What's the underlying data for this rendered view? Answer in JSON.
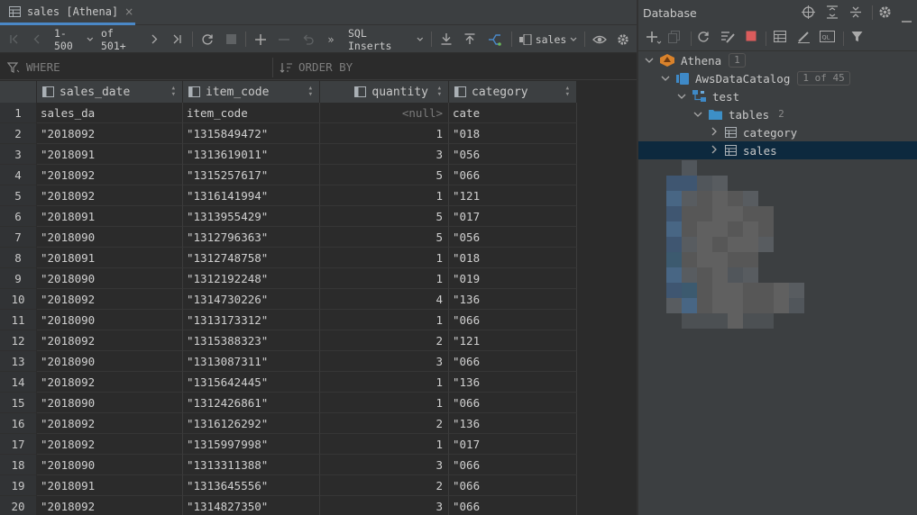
{
  "editor_tab": {
    "label": "sales [Athena]",
    "close": "×"
  },
  "toolbar": {
    "page_range": "1-500",
    "page_total": "of 501+",
    "export_format": "SQL Inserts",
    "schema": "sales"
  },
  "filter": {
    "where_label": "WHERE",
    "order_by_label": "ORDER BY"
  },
  "grid": {
    "columns": [
      "sales_date",
      "item_code",
      "quantity",
      "category"
    ],
    "rows": [
      {
        "n": "1",
        "sales_date": "sales_da",
        "item_code": "item_code",
        "quantity": "<null>",
        "category": "cate"
      },
      {
        "n": "2",
        "sales_date": "\"2018092",
        "item_code": "\"1315849472\"",
        "quantity": "1",
        "category": "\"018"
      },
      {
        "n": "3",
        "sales_date": "\"2018091",
        "item_code": "\"1313619011\"",
        "quantity": "3",
        "category": "\"056"
      },
      {
        "n": "4",
        "sales_date": "\"2018092",
        "item_code": "\"1315257617\"",
        "quantity": "5",
        "category": "\"066"
      },
      {
        "n": "5",
        "sales_date": "\"2018092",
        "item_code": "\"1316141994\"",
        "quantity": "1",
        "category": "\"121"
      },
      {
        "n": "6",
        "sales_date": "\"2018091",
        "item_code": "\"1313955429\"",
        "quantity": "5",
        "category": "\"017"
      },
      {
        "n": "7",
        "sales_date": "\"2018090",
        "item_code": "\"1312796363\"",
        "quantity": "5",
        "category": "\"056"
      },
      {
        "n": "8",
        "sales_date": "\"2018091",
        "item_code": "\"1312748758\"",
        "quantity": "1",
        "category": "\"018"
      },
      {
        "n": "9",
        "sales_date": "\"2018090",
        "item_code": "\"1312192248\"",
        "quantity": "1",
        "category": "\"019"
      },
      {
        "n": "10",
        "sales_date": "\"2018092",
        "item_code": "\"1314730226\"",
        "quantity": "4",
        "category": "\"136"
      },
      {
        "n": "11",
        "sales_date": "\"2018090",
        "item_code": "\"1313173312\"",
        "quantity": "1",
        "category": "\"066"
      },
      {
        "n": "12",
        "sales_date": "\"2018092",
        "item_code": "\"1315388323\"",
        "quantity": "2",
        "category": "\"121"
      },
      {
        "n": "13",
        "sales_date": "\"2018090",
        "item_code": "\"1313087311\"",
        "quantity": "3",
        "category": "\"066"
      },
      {
        "n": "14",
        "sales_date": "\"2018092",
        "item_code": "\"1315642445\"",
        "quantity": "1",
        "category": "\"136"
      },
      {
        "n": "15",
        "sales_date": "\"2018090",
        "item_code": "\"1312426861\"",
        "quantity": "1",
        "category": "\"066"
      },
      {
        "n": "16",
        "sales_date": "\"2018092",
        "item_code": "\"1316126292\"",
        "quantity": "2",
        "category": "\"136"
      },
      {
        "n": "17",
        "sales_date": "\"2018092",
        "item_code": "\"1315997998\"",
        "quantity": "1",
        "category": "\"017"
      },
      {
        "n": "18",
        "sales_date": "\"2018090",
        "item_code": "\"1313311388\"",
        "quantity": "3",
        "category": "\"066"
      },
      {
        "n": "19",
        "sales_date": "\"2018091",
        "item_code": "\"1313645556\"",
        "quantity": "2",
        "category": "\"066"
      },
      {
        "n": "20",
        "sales_date": "\"2018092",
        "item_code": "\"1314827350\"",
        "quantity": "3",
        "category": "\"066"
      }
    ]
  },
  "database_panel": {
    "title": "Database",
    "tree": [
      {
        "label": "Athena",
        "badge": "1",
        "depth": 0,
        "arrow": "v",
        "icon": "athena-icon"
      },
      {
        "label": "AwsDataCatalog",
        "badge": "1 of 45",
        "depth": 1,
        "arrow": "v",
        "icon": "catalog-icon"
      },
      {
        "label": "test",
        "badge": "",
        "depth": 2,
        "arrow": "v",
        "icon": "schema-icon"
      },
      {
        "label": "tables",
        "badge": "2",
        "depth": 3,
        "arrow": "v",
        "icon": "folder-icon"
      },
      {
        "label": "category",
        "badge": "",
        "depth": 4,
        "arrow": ">",
        "icon": "table-icon"
      },
      {
        "label": "sales",
        "badge": "",
        "depth": 4,
        "arrow": ">",
        "icon": "table-icon",
        "selected": true
      }
    ]
  },
  "colors": {
    "selection": "#0d293e",
    "accent": "#4a88c7",
    "stop": "#db5c5c",
    "table_icon": "#aab0b5"
  }
}
